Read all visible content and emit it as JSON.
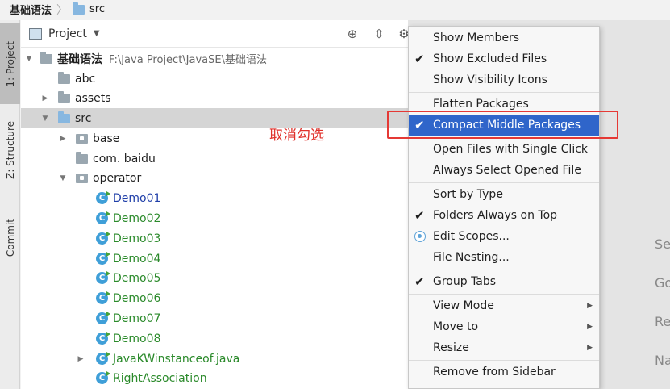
{
  "breadcrumb": {
    "root": "基础语法",
    "child": "src"
  },
  "strip": {
    "project_tab": "1: Project",
    "structure_tab": "Z: Structure",
    "commit_tab": "Commit"
  },
  "panel": {
    "title": "Project"
  },
  "tree": {
    "root": {
      "name": "基础语法",
      "path": "F:\\Java Project\\JavaSE\\基础语法"
    },
    "items": [
      {
        "name": "abc"
      },
      {
        "name": "assets"
      },
      {
        "name": "src"
      },
      {
        "name": "base"
      },
      {
        "name": "com. baidu"
      },
      {
        "name": "operator"
      },
      {
        "name": "Demo01"
      },
      {
        "name": "Demo02"
      },
      {
        "name": "Demo03"
      },
      {
        "name": "Demo04"
      },
      {
        "name": "Demo05"
      },
      {
        "name": "Demo06"
      },
      {
        "name": "Demo07"
      },
      {
        "name": "Demo08"
      },
      {
        "name": "JavaKWinstanceof.java"
      },
      {
        "name": "RightAssociation"
      }
    ]
  },
  "annotation": "取消勾选",
  "menu": {
    "items": [
      {
        "label": "Show Members"
      },
      {
        "label": "Show Excluded Files"
      },
      {
        "label": "Show Visibility Icons"
      },
      {
        "label": "Flatten Packages"
      },
      {
        "label": "Compact Middle Packages"
      },
      {
        "label": "Open Files with Single Click"
      },
      {
        "label": "Always Select Opened File"
      },
      {
        "label": "Sort by Type"
      },
      {
        "label": "Folders Always on Top"
      },
      {
        "label": "Edit Scopes..."
      },
      {
        "label": "File Nesting..."
      },
      {
        "label": "Group Tabs"
      },
      {
        "label": "View Mode"
      },
      {
        "label": "Move to"
      },
      {
        "label": "Resize"
      },
      {
        "label": "Remove from Sidebar"
      }
    ]
  },
  "editor_hints": [
    "Se",
    "Go",
    "Re",
    "Na"
  ],
  "colors": {
    "selection": "#2f65ca",
    "annotation": "#e0322c",
    "class_green": "#2b8a2b",
    "class_blue": "#1f3ea8"
  }
}
